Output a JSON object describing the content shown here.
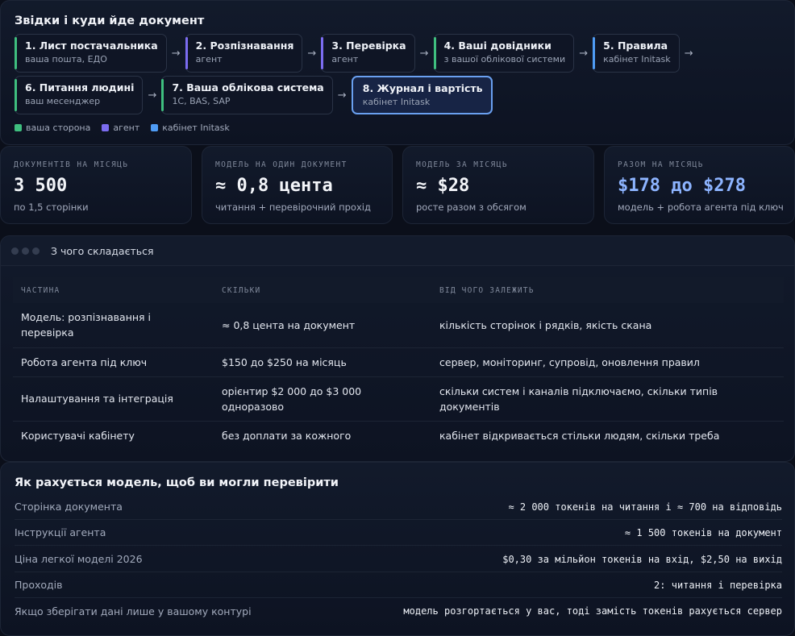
{
  "flow": {
    "title": "Звідки і куди йде документ",
    "nodes": [
      {
        "title": "1. Лист постачальника",
        "sub": "ваша пошта, ЕДО",
        "color": "#3fbf7f"
      },
      {
        "title": "2. Розпізнавання",
        "sub": "агент",
        "color": "#7b6cf0"
      },
      {
        "title": "3. Перевірка",
        "sub": "агент",
        "color": "#7b6cf0"
      },
      {
        "title": "4. Ваші довідники",
        "sub": "з вашої облікової системи",
        "color": "#3fbf7f"
      },
      {
        "title": "5. Правила",
        "sub": "кабінет Initask",
        "color": "#4f9cf5"
      },
      {
        "title": "6. Питання людині",
        "sub": "ваш месенджер",
        "color": "#3fbf7f"
      },
      {
        "title": "7. Ваша облікова система",
        "sub": "1С, BAS, SAP",
        "color": "#3fbf7f"
      },
      {
        "title": "8. Журнал і вартість",
        "sub": "кабінет Initask",
        "color": "#4f9cf5"
      }
    ],
    "arrow": "→",
    "legend": [
      {
        "label": "ваша сторона",
        "color": "#3fbf7f"
      },
      {
        "label": "агент",
        "color": "#7b6cf0"
      },
      {
        "label": "кабінет Initask",
        "color": "#4f9cf5"
      }
    ]
  },
  "stats": [
    {
      "label": "ДОКУМЕНТІВ НА МІСЯЦЬ",
      "value": "3 500",
      "sub": "по 1,5 сторінки"
    },
    {
      "label": "МОДЕЛЬ НА ОДИН ДОКУМЕНТ",
      "value": "≈ 0,8 цента",
      "sub": "читання + перевірочний прохід"
    },
    {
      "label": "МОДЕЛЬ ЗА МІСЯЦЬ",
      "value": "≈ $28",
      "sub": "росте разом з обсягом"
    },
    {
      "label": "РАЗОМ НА МІСЯЦЬ",
      "value": "$178 до $278",
      "sub": "модель + робота агента під ключ"
    }
  ],
  "breakdown": {
    "title": "З чого складається",
    "headers": [
      "ЧАСТИНА",
      "СКІЛЬКИ",
      "ВІД ЧОГО ЗАЛЕЖИТЬ"
    ],
    "rows": [
      [
        "Модель: розпізнавання і перевірка",
        "≈ 0,8 цента на документ",
        "кількість сторінок і рядків, якість скана"
      ],
      [
        "Робота агента під ключ",
        "$150 до $250 на місяць",
        "сервер, моніторинг, супровід, оновлення правил"
      ],
      [
        "Налаштування та інтеграція",
        "орієнтир $2 000 до $3 000 одноразово",
        "скільки систем і каналів підключаємо, скільки типів документів"
      ],
      [
        "Користувачі кабінету",
        "без доплати за кожного",
        "кабінет відкривається стільки людям, скільки треба"
      ]
    ]
  },
  "calc": {
    "title": "Як рахується модель, щоб ви могли перевірити",
    "rows": [
      {
        "k": "Сторінка документа",
        "v": "≈ 2 000 токенів на читання і ≈ 700 на відповідь"
      },
      {
        "k": "Інструкції агента",
        "v": "≈ 1 500 токенів на документ"
      },
      {
        "k": "Ціна легкої моделі 2026",
        "v": "$0,30 за мільйон токенів на вхід, $2,50 на вихід"
      },
      {
        "k": "Проходів",
        "v": "2: читання і перевірка"
      },
      {
        "k": "Якщо зберігати дані лише у вашому контурі",
        "v": "модель розгортається у вас, тоді замість токенів рахується сервер"
      }
    ]
  }
}
